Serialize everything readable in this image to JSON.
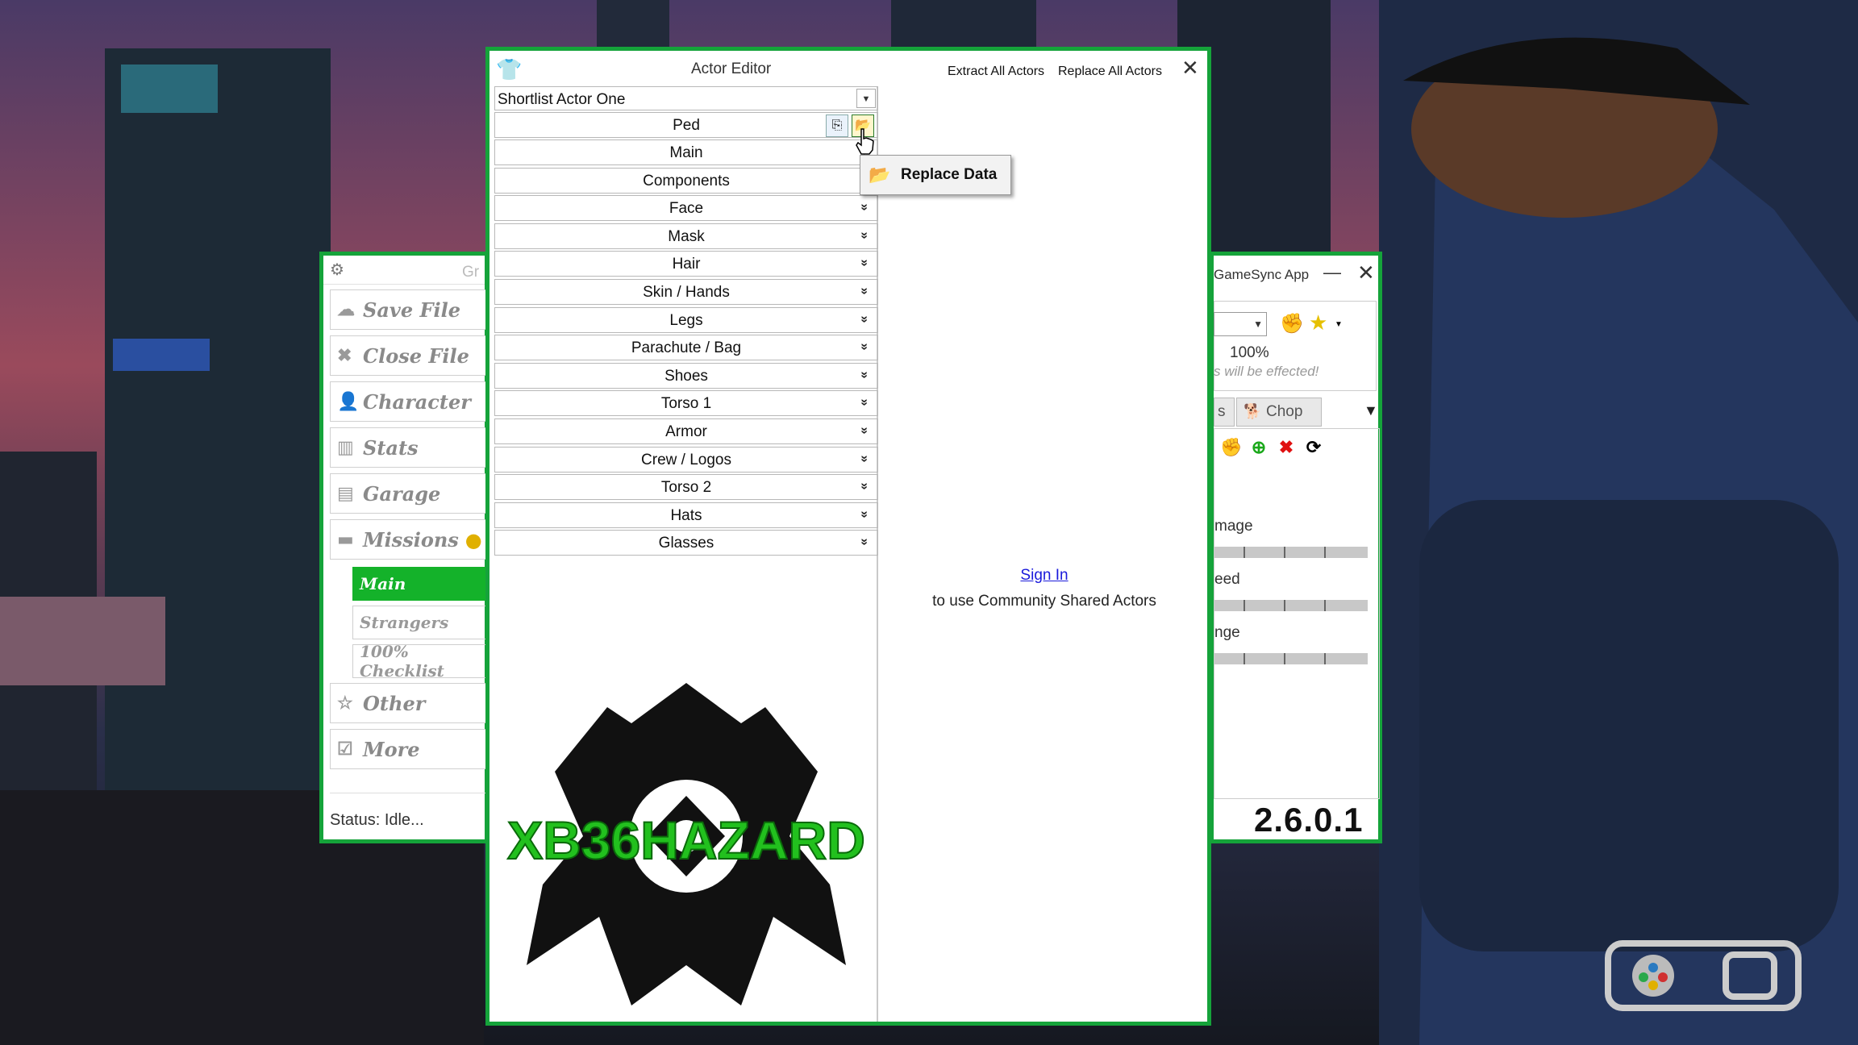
{
  "actor_editor": {
    "title": "Actor Editor",
    "extract_all": "Extract All Actors",
    "replace_all": "Replace All Actors",
    "close_glyph": "✕",
    "actor_dropdown": "Shortlist Actor One",
    "ped_label": "Ped",
    "sections": [
      "Main",
      "Components",
      "Face",
      "Mask",
      "Hair",
      "Skin / Hands",
      "Legs",
      "Parachute / Bag",
      "Shoes",
      "Torso 1",
      "Armor",
      "Crew / Logos",
      "Torso 2",
      "Hats",
      "Glasses"
    ],
    "logo_text": "XB36HAZARD",
    "sign_in": "Sign In",
    "sign_in_sub": "to use Community Shared Actors"
  },
  "popup": {
    "label": "Replace Data"
  },
  "left_app": {
    "title_partial": "Gr",
    "menu": [
      "Save File",
      "Close File",
      "Character",
      "Stats",
      "Garage",
      "Missions",
      "Other",
      "More"
    ],
    "submenu": [
      "Main",
      "Strangers",
      "100% Checklist"
    ],
    "status": "Status: Idle..."
  },
  "right_app": {
    "title": "GameSync App",
    "minimize": "—",
    "close_glyph": "✕",
    "percent": "100%",
    "effected_text": "s will be effected!",
    "tab_partial": "s",
    "tab_chop": "Chop",
    "labels": [
      "mage",
      "eed",
      "nge"
    ],
    "version": "2.6.0.1"
  },
  "colors": {
    "accent_green": "#15a33a",
    "logo_green": "#22c01e"
  }
}
